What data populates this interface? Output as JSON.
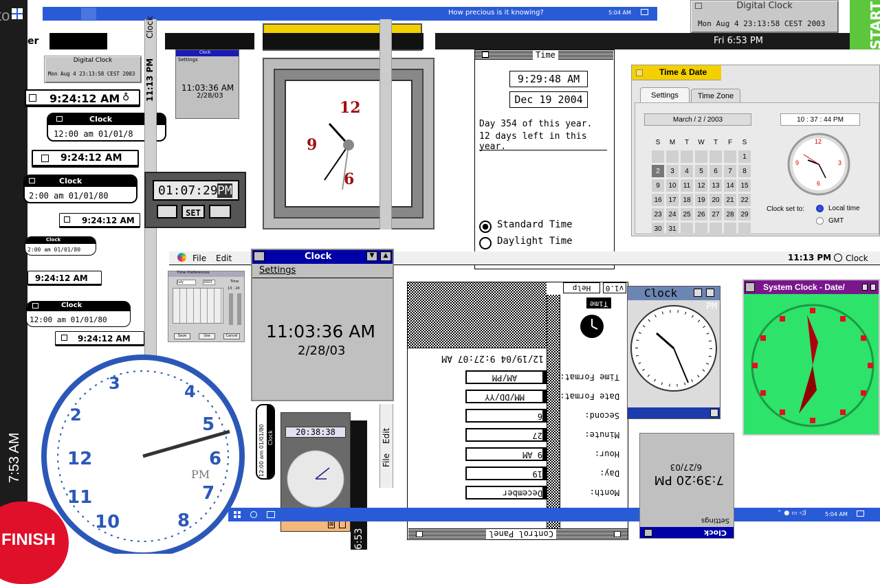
{
  "top_taskbar": {
    "message": "How precious is it knowing?",
    "time": "5:04 AM"
  },
  "left_edge": {
    "to_text": "to",
    "vertical_time": "7:53 AM",
    "finish": "FINISH"
  },
  "right_edge": {
    "start": "START"
  },
  "digital_clock_top": {
    "title": "Digital Clock",
    "value": "Mon Aug  4 23:13:58 CEST 2003"
  },
  "digital_clock_small": {
    "title": "Digital Clock",
    "value": "Mon Aug  4 23:13:58 CEST 2003"
  },
  "er_text": "er",
  "mini_time_1": "9:24:12 AM",
  "mini_time_2": "9:24:12 AM",
  "mini_time_3": "9:24:12 AM",
  "mini_time_4": "9:24:12 AM",
  "mini_time_5": "9:24:12 AM",
  "pill_clock_1": {
    "title": "Clock",
    "value": "12:00 am   01/01/8"
  },
  "pill_clock_2": {
    "title": "Clock",
    "value": "2:00 am   01/01/80"
  },
  "pill_clock_3": {
    "title": "Clock",
    "value": "2:00 am   01/01/80"
  },
  "pill_clock_4": {
    "title": "Clock",
    "value": "12:00 am   01/01/80"
  },
  "vertical_clock_bar": {
    "time": "11:13 PM",
    "label": "Clock"
  },
  "small_win_clock": {
    "title": "Clock",
    "menu": "Settings",
    "time": "11:03:36 AM",
    "date": "2/28/03"
  },
  "lcd_clock": {
    "time": "01:07:29",
    "ampm": "PM",
    "set": "SET"
  },
  "analog_square": {
    "n12": "12",
    "n9": "9",
    "n6": "6"
  },
  "dark_bar": {
    "time": "Fri 6:53 PM"
  },
  "time_da": {
    "title": "Time",
    "time": "9:29:48 AM",
    "date": "Dec 19 2004",
    "day_line": "Day 354 of this year.",
    "left_line": "12 days left in this year.",
    "standard": "Standard Time",
    "daylight": "Daylight Time"
  },
  "time_date": {
    "title": "Time & Date",
    "tab_settings": "Settings",
    "tab_timezone": "Time Zone",
    "date_field": "March  /  2  /  2003",
    "time_field": "10 : 37 : 44  PM",
    "days_header": [
      "S",
      "M",
      "T",
      "W",
      "T",
      "F",
      "S"
    ],
    "weeks": [
      [
        "",
        "",
        "",
        "",
        "",
        "",
        "1"
      ],
      [
        "2",
        "3",
        "4",
        "5",
        "6",
        "7",
        "8"
      ],
      [
        "9",
        "10",
        "11",
        "12",
        "13",
        "14",
        "15"
      ],
      [
        "16",
        "17",
        "18",
        "19",
        "20",
        "21",
        "22"
      ],
      [
        "23",
        "24",
        "25",
        "26",
        "27",
        "28",
        "29"
      ],
      [
        "30",
        "31",
        "",
        "",
        "",
        "",
        ""
      ]
    ],
    "clock_set_to": "Clock set to:",
    "local": "Local time",
    "gmt": "GMT",
    "n12": "12",
    "n3": "3",
    "n6": "6",
    "n9": "9"
  },
  "menubar": {
    "file": "File",
    "edit": "Edit",
    "time": "11:13 PM",
    "clock": "Clock"
  },
  "big_clock_win": {
    "title": "Clock",
    "menu": "Settings",
    "time": "11:03:36 AM",
    "date": "2/28/03"
  },
  "time_prefs": {
    "title": "Time Preferences",
    "month": "July",
    "year": "2003",
    "time_label": "Time",
    "time_value": "13 : 24",
    "buttons": [
      "Save",
      "Use",
      "Cancel"
    ]
  },
  "control_panel": {
    "title": "Control Panel",
    "help": "Help",
    "version": "v1.0",
    "time_tab": "Time",
    "datetime": "12/19/04 9:27:07 AM",
    "rows": [
      {
        "label": "Time Format:",
        "value": "AM/PM"
      },
      {
        "label": "Date Format:",
        "value": "MM/DD/YY"
      },
      {
        "label": "Second:",
        "value": "6"
      },
      {
        "label": "Minute:",
        "value": "27"
      },
      {
        "label": "Hour:",
        "value": "9 AM"
      },
      {
        "label": "Day:",
        "value": "19"
      },
      {
        "label": "Month:",
        "value": "December"
      }
    ]
  },
  "mac_clock": {
    "title": "Clock",
    "pm": "PM"
  },
  "system_clock": {
    "title": "System Clock - Date/"
  },
  "gray_clock": {
    "time": "7:39:20 PM",
    "date": "6/27/03",
    "menu": "Settings",
    "title": "Clock"
  },
  "palm_clock": {
    "time": "20:38:38"
  },
  "vertical_file_edit": {
    "file": "File",
    "edit": "Edit"
  },
  "vertical_pill": {
    "title": "Clock",
    "value": "12:00 am   01/01/80"
  },
  "bottom_taskbar": {
    "time": "5:04 AM"
  },
  "bottom_vertical_time": "6:53",
  "colors": {
    "win_blue": "#2a5bd7",
    "green_bg": "#2de36a",
    "start_green": "#5cc63c",
    "finish_red": "#e0102a"
  }
}
